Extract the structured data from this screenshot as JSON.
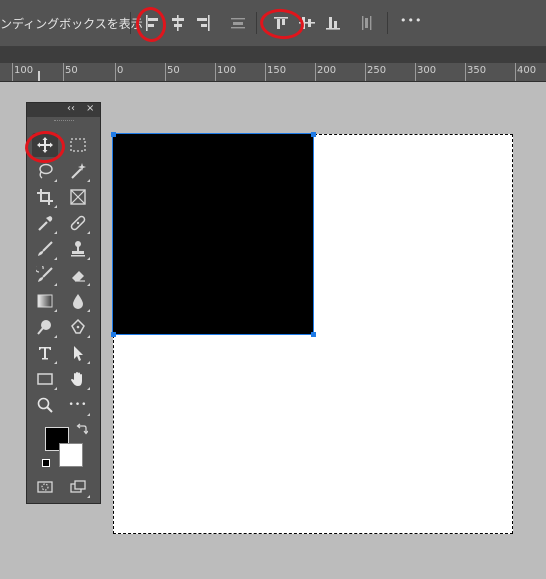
{
  "options_bar": {
    "show_transform_label": "ンディングボックスを表示"
  },
  "ruler": {
    "labels": [
      "100",
      "50",
      "0",
      "50",
      "100",
      "150",
      "200",
      "250",
      "300",
      "350",
      "400"
    ]
  },
  "icons": {
    "align_left": "align-left-edges-icon",
    "align_hcenter": "align-horizontal-centers-icon",
    "align_right": "align-right-edges-icon",
    "distribute_v": "distribute-vertical-icon",
    "align_top": "align-top-edges-icon",
    "align_vcenter": "align-vertical-centers-icon",
    "align_bottom": "align-bottom-edges-icon",
    "distribute_h": "distribute-horizontal-icon",
    "more": "more-options-icon"
  },
  "colors": {
    "annotation": "#e0151c",
    "selection": "#1e7ae6",
    "foreground": "#000000",
    "background": "#ffffff"
  },
  "tools_panel": {
    "collapse_glyph": "‹‹",
    "close_glyph": "×",
    "active_tool": "move-tool"
  },
  "more_glyph": "•••"
}
